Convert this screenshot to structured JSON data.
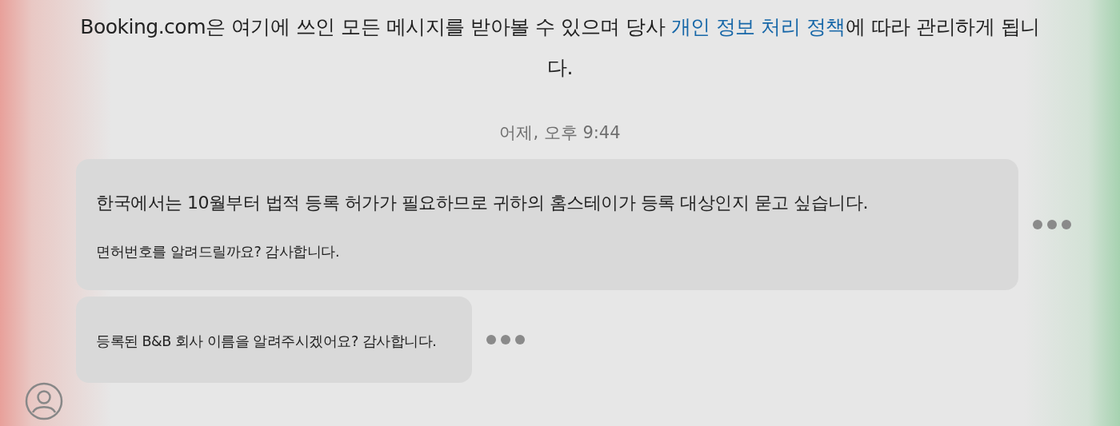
{
  "notice": {
    "text_before": "Booking.com은 여기에 쓰인 모든 메시지를 받아볼 수 있으며 당사 ",
    "link": "개인 정보 처리 정책",
    "text_after": "에 따라 관리하게 됩니다."
  },
  "timestamp": "어제, 오후 9:44",
  "messages": [
    {
      "paragraphs": [
        "한국에서는 10월부터 법적 등록 허가가 필요하므로 귀하의 홈스테이가 등록 대상인지 묻고 싶습니다.",
        "면허번호를 알려드릴까요? 감사합니다."
      ]
    },
    {
      "paragraphs": [
        "등록된 B&B 회사 이름을 알려주시겠어요? 감사합니다."
      ]
    }
  ]
}
